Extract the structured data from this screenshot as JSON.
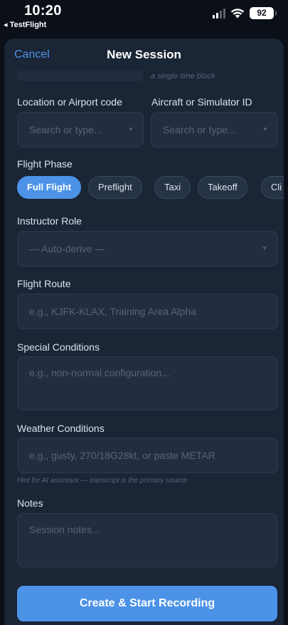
{
  "status_bar": {
    "time": "10:20",
    "back_app": "◂ TestFlight",
    "battery": "92"
  },
  "nav": {
    "cancel_label": "Cancel",
    "title": "New Session"
  },
  "form": {
    "time_block_hint": "a single time block",
    "location": {
      "label": "Location or Airport code",
      "placeholder": "Search or type..."
    },
    "aircraft": {
      "label": "Aircraft or Simulator ID",
      "placeholder": "Search or type..."
    },
    "flight_phase": {
      "label": "Flight Phase",
      "chips": [
        "Full Flight",
        "Preflight",
        "Taxi",
        "Takeoff",
        "Cli"
      ],
      "selected": "Full Flight"
    },
    "instructor_role": {
      "label": "Instructor Role",
      "value": "— Auto-derive —"
    },
    "flight_route": {
      "label": "Flight Route",
      "placeholder": "e.g., KJFK-KLAX, Training Area Alpha"
    },
    "special_conditions": {
      "label": "Special Conditions",
      "placeholder": "e.g., non-normal configuration..."
    },
    "weather_conditions": {
      "label": "Weather Conditions",
      "placeholder": "e.g., gusty, 270/18G28kt, or paste METAR",
      "hint": "Hint for AI assessor — transcript is the primary source"
    },
    "notes": {
      "label": "Notes",
      "placeholder": "Session notes..."
    }
  },
  "actions": {
    "create_label": "Create & Start Recording"
  },
  "colors": {
    "accent": "#4c93e8",
    "sheet_background": "#1a2535",
    "field_background": "#222e40"
  }
}
